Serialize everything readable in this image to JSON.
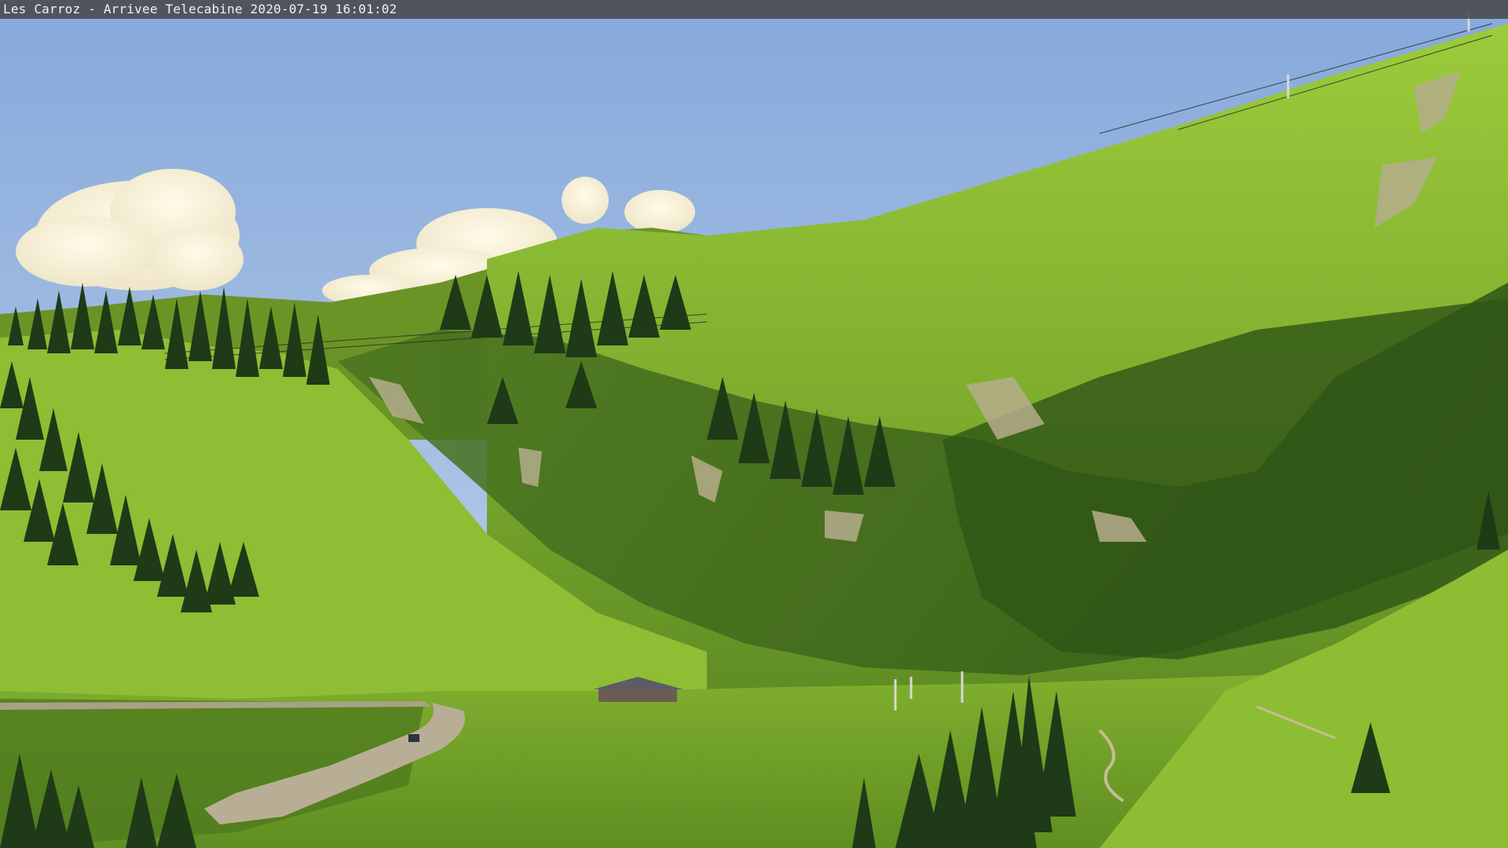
{
  "webcam": {
    "caption": "Les Carroz - Arrivee Telecabine 2020-07-19 16:01:02"
  },
  "colors": {
    "sky_top": "#86a9db",
    "sky_bottom": "#bdd0ea",
    "cloud": "#fbf6e2",
    "cloud_shadow": "#e4dcc0",
    "grass_sunlit": "#9cc93a",
    "grass_mid": "#6f9a28",
    "grass_shade": "#3f6a1c",
    "grass_deep_shade": "#2c4f14",
    "forest": "#1f3a18",
    "track": "#b7ad93",
    "scree": "#b3ab8a",
    "chalet_roof": "#5a5a62",
    "caption_text": "#f2f2f2"
  }
}
